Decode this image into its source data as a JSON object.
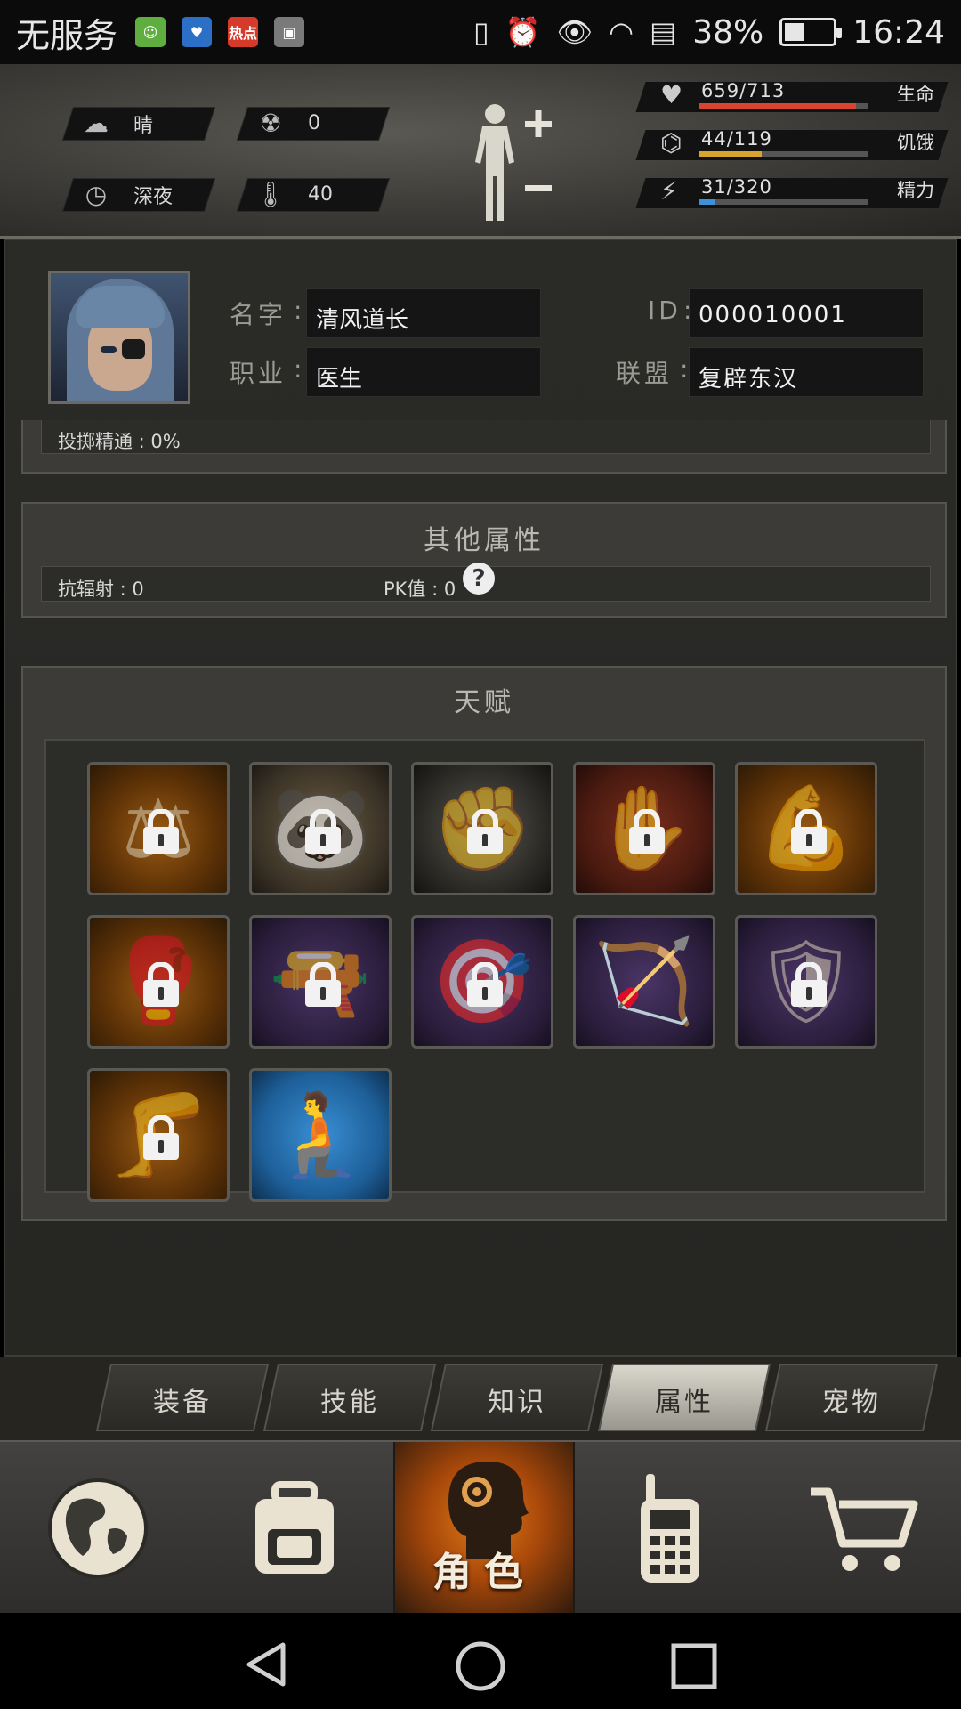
{
  "status_bar": {
    "carrier": "无服务",
    "app_icons": [
      {
        "name": "contacts-app-icon",
        "color": "#5fae3f",
        "text": ""
      },
      {
        "name": "health-app-icon",
        "color": "#2b6fc7",
        "text": ""
      },
      {
        "name": "hot-news-app-icon",
        "color": "#d63a2a",
        "text": "热点"
      },
      {
        "name": "gallery-app-icon",
        "color": "#7a7a7a",
        "text": ""
      }
    ],
    "battery_percent": "38%",
    "battery_level": 0.38,
    "time": "16:24"
  },
  "hud": {
    "weather": "晴",
    "radiation": "0",
    "time_of_day": "深夜",
    "temperature": "40",
    "stats": [
      {
        "label": "生命",
        "value": "659/713",
        "fraction": 0.924,
        "color": "#d9442e",
        "icon": "heart-icon"
      },
      {
        "label": "饥饿",
        "value": "44/119",
        "fraction": 0.37,
        "color": "#d9a42e",
        "icon": "stomach-icon"
      },
      {
        "label": "精力",
        "value": "31/320",
        "fraction": 0.097,
        "color": "#3f8fd9",
        "icon": "brain-icon"
      }
    ]
  },
  "profile": {
    "name_label": "名字",
    "name_value": "清风道长",
    "id_label": "ID",
    "id_value": "000010001",
    "job_label": "职业",
    "job_value": "医生",
    "alliance_label": "联盟",
    "alliance_value": "复辟东汉",
    "throw_mastery": "投掷精通 : 0%"
  },
  "other_attributes": {
    "title": "其他属性",
    "radiation_resist": "抗辐射 : 0",
    "pk_value": "PK值 : 0",
    "help": "?"
  },
  "talents": {
    "title": "天赋",
    "items": [
      {
        "name": "porter-talent",
        "style": "orange",
        "glyph": "⚖",
        "locked": true
      },
      {
        "name": "panda-talent",
        "style": "sepia",
        "glyph": "🐼",
        "locked": true
      },
      {
        "name": "brawler-talent",
        "style": "dark",
        "glyph": "✊",
        "locked": true
      },
      {
        "name": "grip-talent",
        "style": "red",
        "glyph": "✋",
        "locked": true
      },
      {
        "name": "strongman-talent",
        "style": "orange",
        "glyph": "💪",
        "locked": true
      },
      {
        "name": "boxer-talent",
        "style": "orange",
        "glyph": "🥊",
        "locked": true
      },
      {
        "name": "pistol-talent",
        "style": "purple",
        "glyph": "🔫",
        "locked": true
      },
      {
        "name": "rifle-talent",
        "style": "purple",
        "glyph": "🎯",
        "locked": true
      },
      {
        "name": "archer-talent",
        "style": "purple",
        "glyph": "🏹",
        "locked": false
      },
      {
        "name": "shield-talent",
        "style": "purple",
        "glyph": "🛡",
        "locked": true
      },
      {
        "name": "kick-talent",
        "style": "orange",
        "glyph": "🦵",
        "locked": true
      },
      {
        "name": "crouch-talent",
        "style": "blue",
        "glyph": "🧎",
        "locked": false
      }
    ]
  },
  "tabs": [
    {
      "label": "装备",
      "active": false
    },
    {
      "label": "技能",
      "active": false
    },
    {
      "label": "知识",
      "active": false
    },
    {
      "label": "属性",
      "active": true
    },
    {
      "label": "宠物",
      "active": false
    }
  ],
  "bottom_nav": {
    "active_label": "角色",
    "items": [
      "globe-icon",
      "backpack-icon",
      "character-icon",
      "walkie-talkie-icon",
      "shopping-cart-icon"
    ]
  }
}
